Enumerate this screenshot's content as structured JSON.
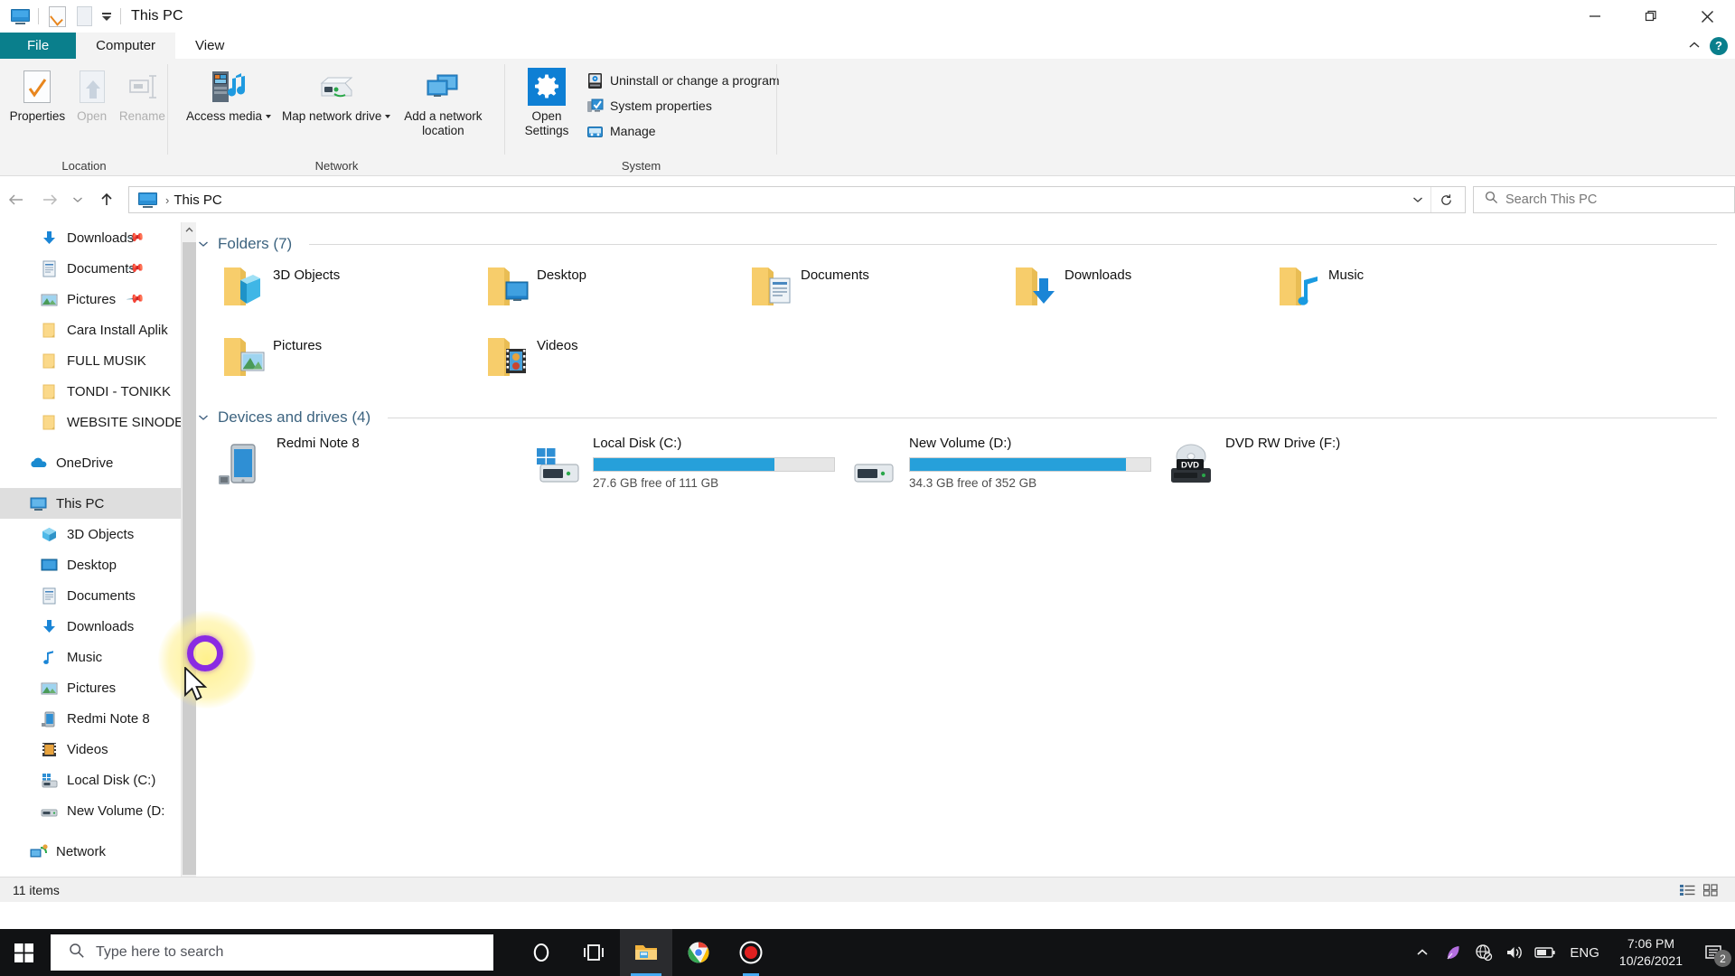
{
  "window": {
    "title": "This PC",
    "quick_access": [
      "monitor-icon",
      "properties-icon",
      "new-folder-icon"
    ],
    "controls": {
      "minimize": "minimize-icon",
      "maximize": "restore-icon",
      "close": "close-icon"
    }
  },
  "ribbon": {
    "tabs": [
      {
        "label": "File",
        "kind": "file"
      },
      {
        "label": "Computer",
        "kind": "active"
      },
      {
        "label": "View",
        "kind": "normal"
      }
    ],
    "collapse_icon": "chevron-up-icon",
    "help_label": "?",
    "groups": [
      {
        "name": "Location",
        "buttons": [
          {
            "label": "Properties",
            "icon": "properties-icon",
            "enabled": true
          },
          {
            "label": "Open",
            "icon": "open-icon",
            "enabled": false
          },
          {
            "label": "Rename",
            "icon": "rename-icon",
            "enabled": false
          }
        ]
      },
      {
        "name": "Network",
        "buttons": [
          {
            "label": "Access media",
            "icon": "access-media-icon",
            "split": true,
            "enabled": true
          },
          {
            "label": "Map network drive",
            "icon": "map-network-drive-icon",
            "split": true,
            "enabled": true
          },
          {
            "label": "Add a network location",
            "icon": "add-network-location-icon",
            "split": false,
            "enabled": true
          }
        ]
      },
      {
        "name": "System",
        "buttons": [
          {
            "label": "Open Settings",
            "icon": "open-settings-icon",
            "enabled": true
          }
        ],
        "small_items": [
          {
            "label": "Uninstall or change a program",
            "icon": "uninstall-program-icon"
          },
          {
            "label": "System properties",
            "icon": "system-properties-icon"
          },
          {
            "label": "Manage",
            "icon": "manage-icon"
          }
        ]
      }
    ]
  },
  "address_bar": {
    "back": "back-arrow-icon",
    "forward": "forward-arrow-icon",
    "recent": "recent-locations-icon",
    "up": "up-arrow-icon",
    "breadcrumb_icon": "this-pc-icon",
    "breadcrumb_separator": "›",
    "path": "This PC",
    "dropdown": "chevron-down-icon",
    "refresh": "refresh-icon",
    "search_placeholder": "Search This PC"
  },
  "nav_pane": {
    "items": [
      {
        "label": "Downloads",
        "icon": "downloads-icon",
        "level": 2,
        "pinned": true
      },
      {
        "label": "Documents",
        "icon": "documents-icon",
        "level": 2,
        "pinned": true
      },
      {
        "label": "Pictures",
        "icon": "pictures-icon",
        "level": 2,
        "pinned": true
      },
      {
        "label": "Cara Install Aplik",
        "icon": "folder-icon",
        "level": 2,
        "pinned": false
      },
      {
        "label": "FULL MUSIK",
        "icon": "folder-icon",
        "level": 2,
        "pinned": false
      },
      {
        "label": "TONDI - TONIKK",
        "icon": "folder-icon",
        "level": 2,
        "pinned": false
      },
      {
        "label": "WEBSITE SINODE",
        "icon": "folder-icon",
        "level": 2,
        "pinned": false
      },
      {
        "label": "",
        "icon": "spacer",
        "level": 0,
        "pinned": false
      },
      {
        "label": "OneDrive",
        "icon": "onedrive-icon",
        "level": 1,
        "pinned": false
      },
      {
        "label": "",
        "icon": "spacer",
        "level": 0,
        "pinned": false
      },
      {
        "label": "This PC",
        "icon": "this-pc-icon",
        "level": 1,
        "pinned": false,
        "selected": true
      },
      {
        "label": "3D Objects",
        "icon": "3d-objects-icon",
        "level": 2,
        "pinned": false
      },
      {
        "label": "Desktop",
        "icon": "desktop-icon",
        "level": 2,
        "pinned": false
      },
      {
        "label": "Documents",
        "icon": "documents-icon",
        "level": 2,
        "pinned": false
      },
      {
        "label": "Downloads",
        "icon": "downloads-icon",
        "level": 2,
        "pinned": false
      },
      {
        "label": "Music",
        "icon": "music-icon",
        "level": 2,
        "pinned": false
      },
      {
        "label": "Pictures",
        "icon": "pictures-icon",
        "level": 2,
        "pinned": false
      },
      {
        "label": "Redmi Note 8",
        "icon": "phone-icon",
        "level": 2,
        "pinned": false
      },
      {
        "label": "Videos",
        "icon": "videos-icon",
        "level": 2,
        "pinned": false
      },
      {
        "label": "Local Disk (C:)",
        "icon": "windows-drive-icon",
        "level": 2,
        "pinned": false
      },
      {
        "label": "New Volume (D:",
        "icon": "drive-icon",
        "level": 2,
        "pinned": false
      },
      {
        "label": "",
        "icon": "spacer",
        "level": 0,
        "pinned": false
      },
      {
        "label": "Network",
        "icon": "network-icon",
        "level": 1,
        "pinned": false
      }
    ]
  },
  "main": {
    "folders_group": {
      "title": "Folders (7)",
      "caret": "chevron-down-icon",
      "items": [
        {
          "name": "3D Objects",
          "icon": "folder-3d-objects-icon"
        },
        {
          "name": "Desktop",
          "icon": "folder-desktop-icon"
        },
        {
          "name": "Documents",
          "icon": "folder-documents-icon"
        },
        {
          "name": "Downloads",
          "icon": "folder-downloads-icon"
        },
        {
          "name": "Music",
          "icon": "folder-music-icon"
        },
        {
          "name": "Pictures",
          "icon": "folder-pictures-icon"
        },
        {
          "name": "Videos",
          "icon": "folder-videos-icon"
        }
      ]
    },
    "devices_group": {
      "title": "Devices and drives (4)",
      "caret": "chevron-down-icon",
      "items": [
        {
          "name": "Redmi Note 8",
          "icon": "phone-icon",
          "has_bar": false,
          "free_text": ""
        },
        {
          "name": "Local Disk (C:)",
          "icon": "windows-drive-icon",
          "has_bar": true,
          "used_percent": 75,
          "free_text": "27.6 GB free of 111 GB"
        },
        {
          "name": "New Volume (D:)",
          "icon": "drive-icon",
          "has_bar": true,
          "used_percent": 90,
          "free_text": "34.3 GB free of 352 GB"
        },
        {
          "name": "DVD RW Drive (F:)",
          "icon": "dvd-drive-icon",
          "has_bar": false,
          "free_text": ""
        }
      ]
    }
  },
  "status_bar": {
    "item_count": "11 items",
    "view_buttons": [
      "details-view-icon",
      "large-icons-view-icon"
    ]
  },
  "taskbar": {
    "start": "windows-start-icon",
    "search_placeholder": "Type here to search",
    "pinned": [
      {
        "name": "cortana-icon",
        "active": false
      },
      {
        "name": "task-view-icon",
        "active": false
      },
      {
        "name": "file-explorer-icon",
        "active": true
      },
      {
        "name": "chrome-icon",
        "active": false
      },
      {
        "name": "recorder-icon",
        "active": false
      }
    ],
    "tray": {
      "overflow": "chevron-up-icon",
      "icons": [
        "feather-icon",
        "network-offline-icon",
        "volume-icon",
        "battery-icon"
      ],
      "language": "ENG",
      "time": "7:06 PM",
      "date": "10/26/2021",
      "notifications": "notification-icon",
      "notification_count": "2"
    }
  },
  "colors": {
    "accent": "#26a0da",
    "file_tab": "#0a7f8c",
    "group_title": "#3d6480",
    "selection": "#dedede",
    "taskbar": "#111214"
  }
}
